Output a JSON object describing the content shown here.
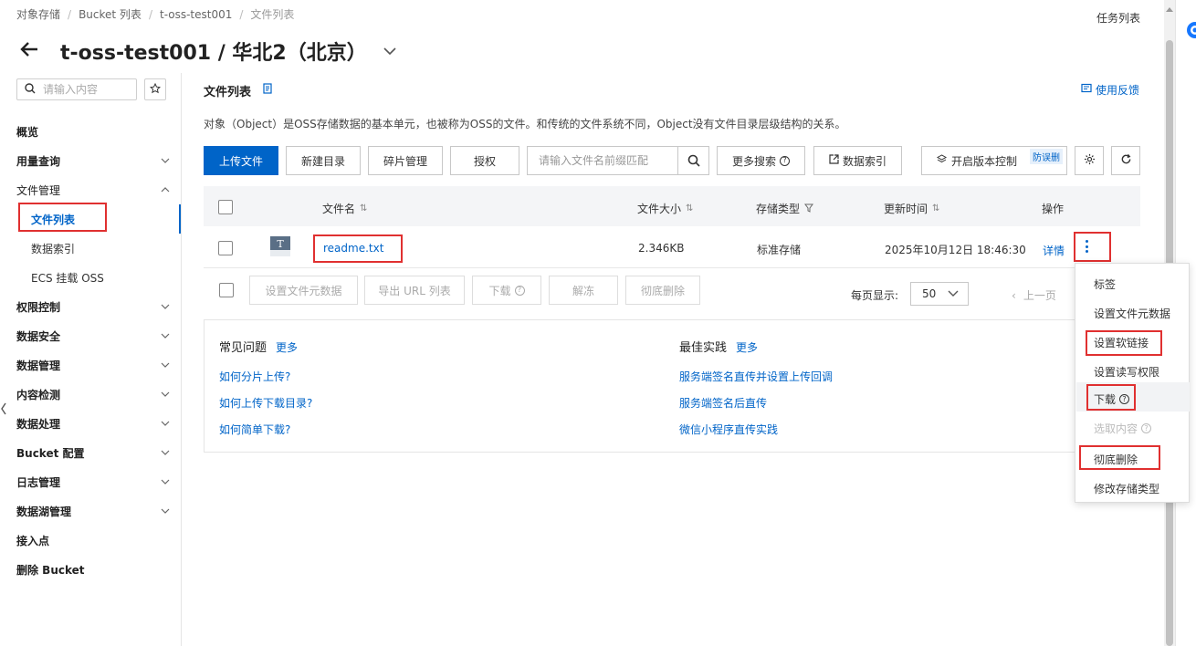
{
  "breadcrumb": {
    "items": [
      "对象存储",
      "Bucket 列表",
      "t-oss-test001"
    ],
    "current": "文件列表"
  },
  "header": {
    "task_list": "任务列表",
    "title": "t-oss-test001 / 华北2（北京）"
  },
  "sidebar": {
    "search_placeholder": "请输入内容",
    "items": [
      {
        "label": "概览"
      },
      {
        "label": "用量查询"
      },
      {
        "label": "文件管理"
      },
      {
        "label": "文件列表"
      },
      {
        "label": "数据索引"
      },
      {
        "label": "ECS 挂载 OSS"
      },
      {
        "label": "权限控制"
      },
      {
        "label": "数据安全"
      },
      {
        "label": "数据管理"
      },
      {
        "label": "内容检测"
      },
      {
        "label": "数据处理"
      },
      {
        "label": "Bucket 配置"
      },
      {
        "label": "日志管理"
      },
      {
        "label": "数据湖管理"
      },
      {
        "label": "接入点"
      },
      {
        "label": "删除 Bucket"
      }
    ]
  },
  "main": {
    "section_title": "文件列表",
    "feedback": "使用反馈",
    "description": "对象（Object）是OSS存储数据的基本单元，也被称为OSS的文件。和传统的文件系统不同，Object没有文件目录层级结构的关系。",
    "toolbar": {
      "upload": "上传文件",
      "new_dir": "新建目录",
      "fragments": "碎片管理",
      "authorize": "授权",
      "search_placeholder": "请输入文件名前缀匹配",
      "more_search": "更多搜索",
      "data_index": "数据索引",
      "versioning": "开启版本控制",
      "anti_delete_tag": "防误删"
    },
    "table": {
      "headers": [
        "文件名",
        "文件大小",
        "存储类型",
        "更新时间",
        "操作"
      ],
      "rows": [
        {
          "name": "readme.txt",
          "size": "2.346KB",
          "storage": "标准存储",
          "updated": "2025年10月12日 18:46:30",
          "action": "详情"
        }
      ]
    },
    "batch": {
      "set_meta": "设置文件元数据",
      "export_url": "导出 URL 列表",
      "download": "下载",
      "unfreeze": "解冻",
      "delete": "彻底删除"
    },
    "pagination": {
      "per_page_label": "每页显示:",
      "per_page": "50",
      "prev": "上一页"
    },
    "faq": {
      "title": "常见问题",
      "more": "更多",
      "links": [
        "如何分片上传?",
        "如何上传下载目录?",
        "如何简单下载?"
      ]
    },
    "best": {
      "title": "最佳实践",
      "more": "更多",
      "links": [
        "服务端签名直传并设置上传回调",
        "服务端签名后直传",
        "微信小程序直传实践"
      ]
    }
  },
  "menu": {
    "items": [
      "标签",
      "设置文件元数据",
      "设置软链接",
      "设置读写权限",
      "下载",
      "选取内容",
      "彻底删除",
      "修改存储类型"
    ]
  },
  "colors": {
    "accent": "#0064c8",
    "highlight_border": "#e03030"
  }
}
